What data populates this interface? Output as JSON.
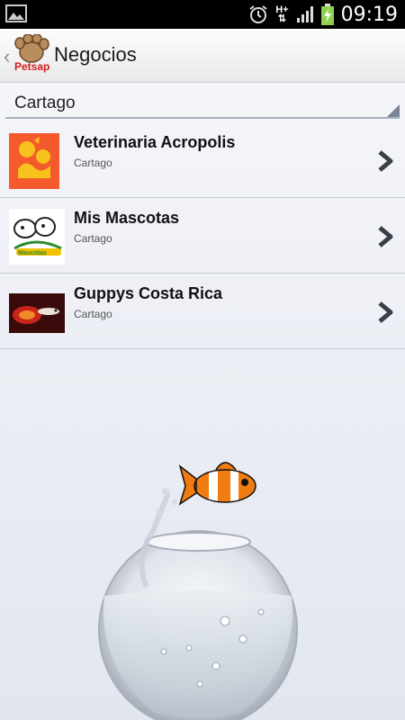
{
  "status_bar": {
    "network": "H+",
    "time": "09:19",
    "icons": [
      "gallery-icon",
      "alarm-icon",
      "network-arrows-icon",
      "signal-icon",
      "battery-charging-icon"
    ]
  },
  "action_bar": {
    "logo_text": "Petsapp",
    "title": "Negocios"
  },
  "filter": {
    "selected": "Cartago"
  },
  "businesses": [
    {
      "name": "Veterinaria Acropolis",
      "location": "Cartago",
      "thumb_color": "#f45a2c"
    },
    {
      "name": "Mis Mascotas",
      "location": "Cartago",
      "thumb_color": "#ffffff"
    },
    {
      "name": "Guppys Costa Rica",
      "location": "Cartago",
      "thumb_color": "#3a0a0a"
    }
  ],
  "colors": {
    "status_bg": "#000000",
    "action_bar_bg": "#f3f3f3",
    "chevron": "#3a3f47",
    "divider": "#c6cad3"
  }
}
